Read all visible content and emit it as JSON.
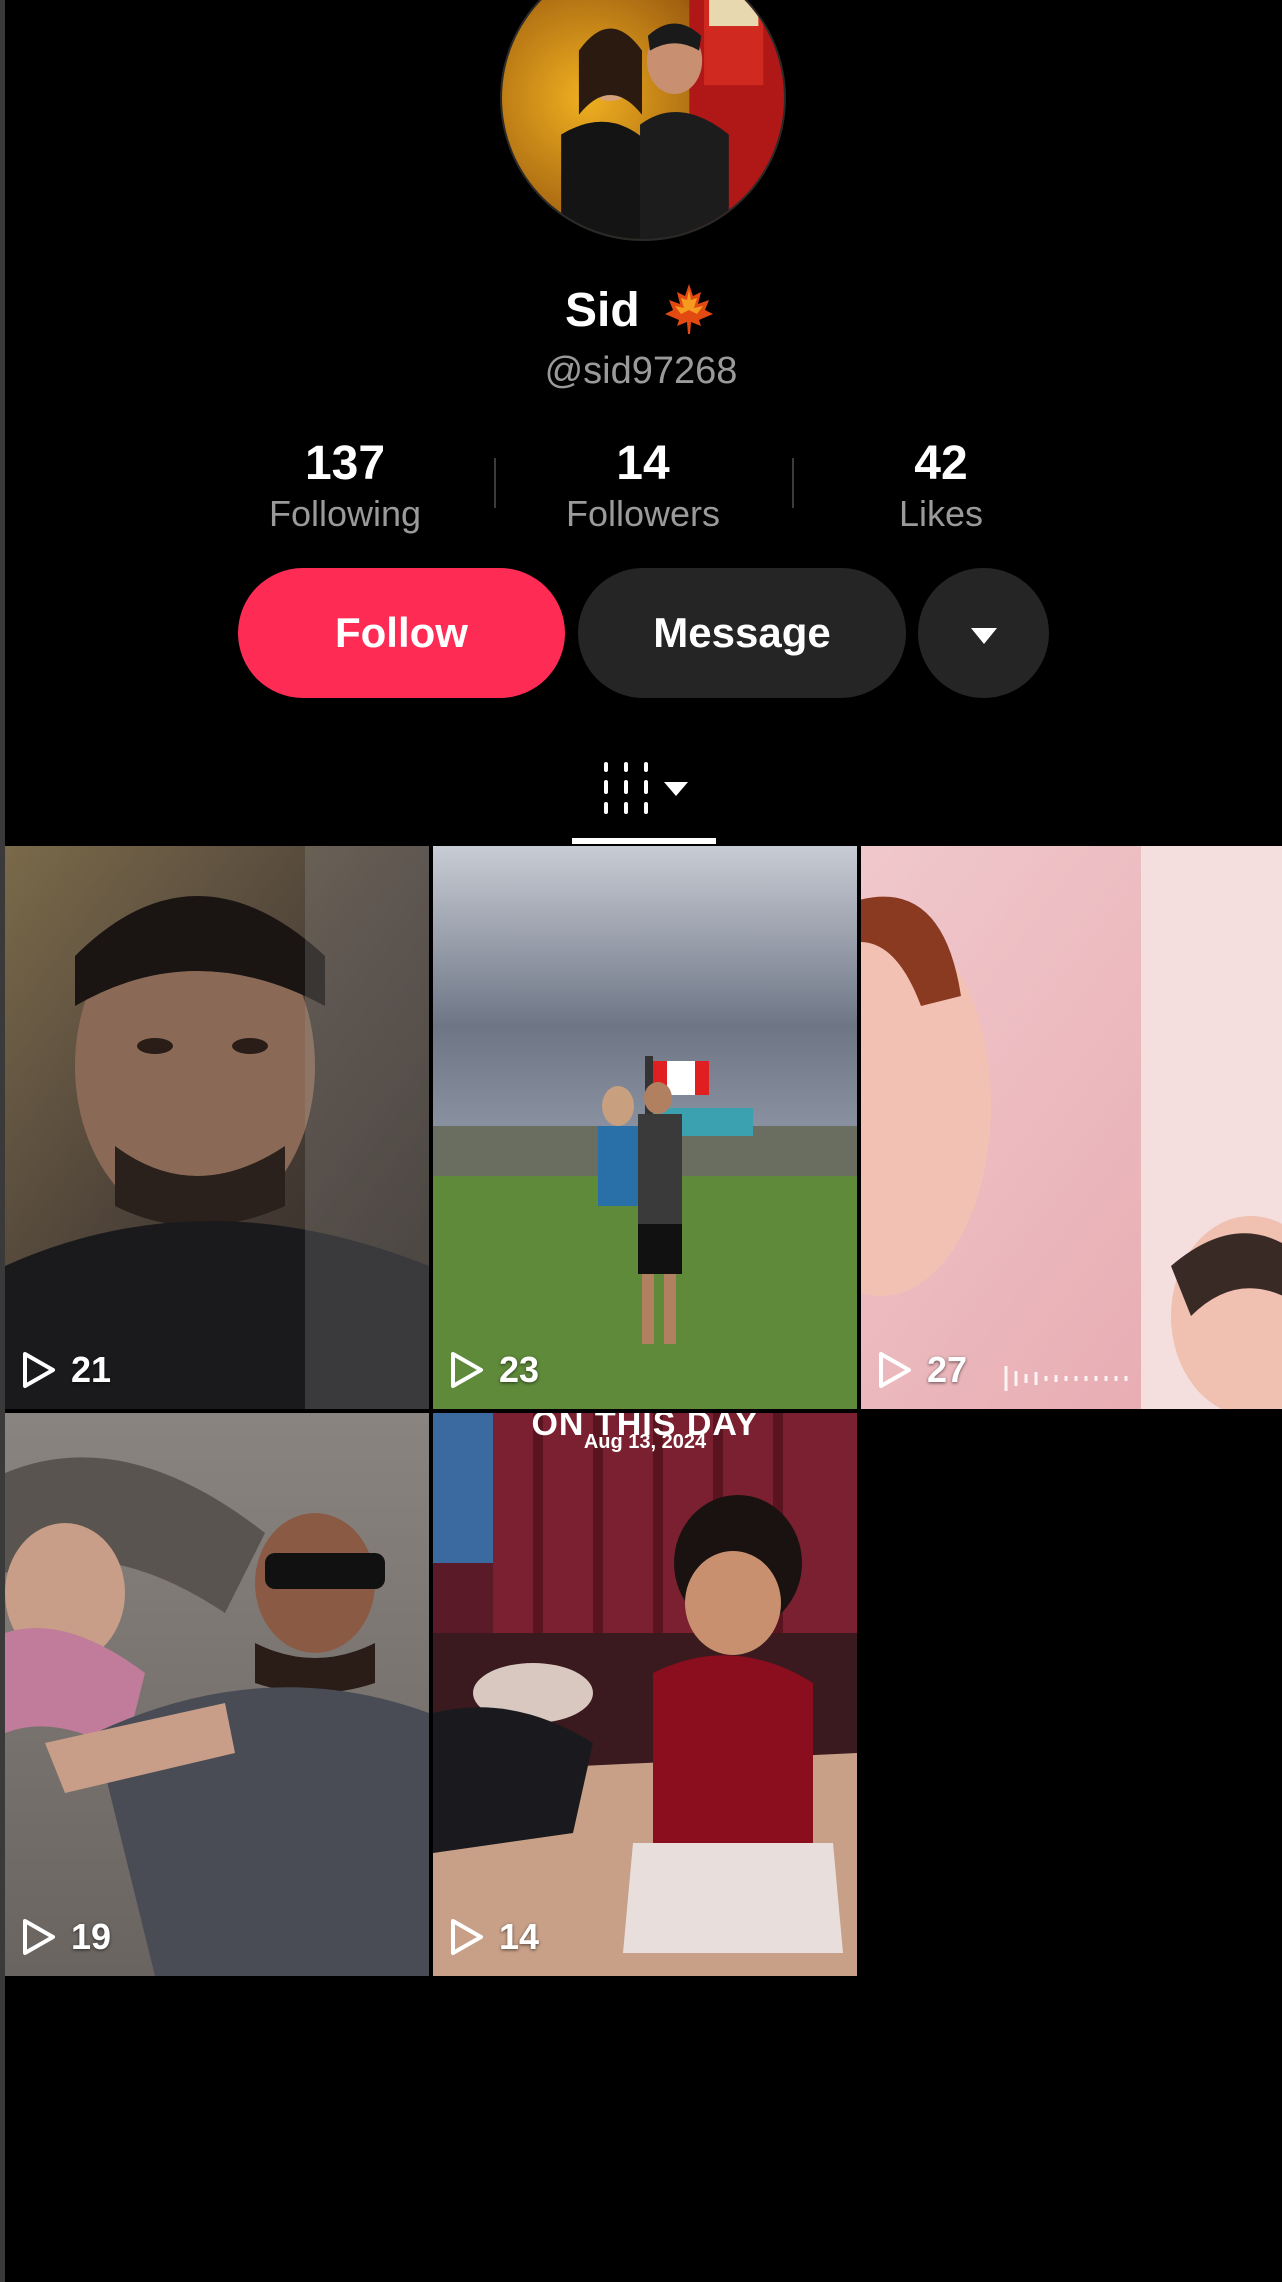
{
  "profile": {
    "display_name": "Sid",
    "handle": "@sid97268",
    "name_badge_icon": "maple-leaf-icon"
  },
  "stats": [
    {
      "value": "137",
      "label": "Following"
    },
    {
      "value": "14",
      "label": "Followers"
    },
    {
      "value": "42",
      "label": "Likes"
    }
  ],
  "actions": {
    "follow_label": "Follow",
    "message_label": "Message",
    "more_icon": "caret-down-icon"
  },
  "tabs": {
    "active_icon": "videos-grid-icon"
  },
  "videos": [
    {
      "views": "21",
      "overlay": "",
      "subtitle": ""
    },
    {
      "views": "23",
      "overlay": "",
      "subtitle": ""
    },
    {
      "views": "27",
      "overlay": "",
      "subtitle": ""
    },
    {
      "views": "19",
      "overlay": "",
      "subtitle": ""
    },
    {
      "views": "14",
      "overlay": "ON THIS DAY",
      "subtitle": "Aug 13, 2024"
    }
  ],
  "colors": {
    "background": "#000000",
    "follow_button": "#fe2c55",
    "secondary_button": "#252525",
    "muted_text": "#9a9a9a"
  }
}
